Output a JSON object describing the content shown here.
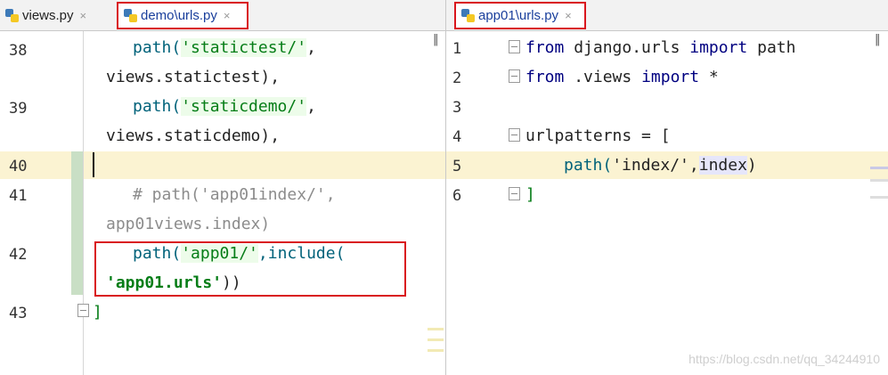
{
  "left_tabs": [
    {
      "name": "views.py",
      "close": "×",
      "active": false
    },
    {
      "name": "demo\\urls.py",
      "close": "×",
      "active": true
    }
  ],
  "right_tabs": [
    {
      "name": "app01\\urls.py",
      "close": "×",
      "active": true
    }
  ],
  "left_editor": {
    "line_numbers": [
      "38",
      "39",
      "40",
      "41",
      "42",
      "43"
    ],
    "code": {
      "l38_fn": "path(",
      "l38_str": "'statictest/'",
      "l38_tail": ",",
      "l38_cont": "views.statictest),",
      "l39_fn": "path(",
      "l39_str": "'staticdemo/'",
      "l39_tail": ",",
      "l39_cont": "views.staticdemo),",
      "l41_comment": "# path('app01index/',",
      "l41_cont": "app01views.index)",
      "l42_fn": "path(",
      "l42_str": "'app01/'",
      "l42_mid": ",include(",
      "l42_cont_str": "'app01.urls'",
      "l42_cont_tail": "))",
      "l43_close": "]"
    }
  },
  "right_editor": {
    "line_numbers": [
      "1",
      "2",
      "3",
      "4",
      "5",
      "6"
    ],
    "code": {
      "l1_kw1": "from",
      "l1_mod": " django.urls ",
      "l1_kw2": "import",
      "l1_name": " path",
      "l2_kw1": "from",
      "l2_mod": " .views ",
      "l2_kw2": "import",
      "l2_name": " *",
      "l4_name": "urlpatterns = [",
      "l5_fn": "path(",
      "l5_str": "'index/'",
      "l5_comma": ",",
      "l5_idx": "index",
      "l5_close": ")",
      "l6_close": "]"
    }
  },
  "pause_glyph": "‖",
  "watermark": "https://blog.csdn.net/qq_34244910",
  "colors": {
    "highlight_box": "#d9161d",
    "current_line": "#fbf3d2",
    "keyword": "#000080",
    "string": "#067d17"
  }
}
